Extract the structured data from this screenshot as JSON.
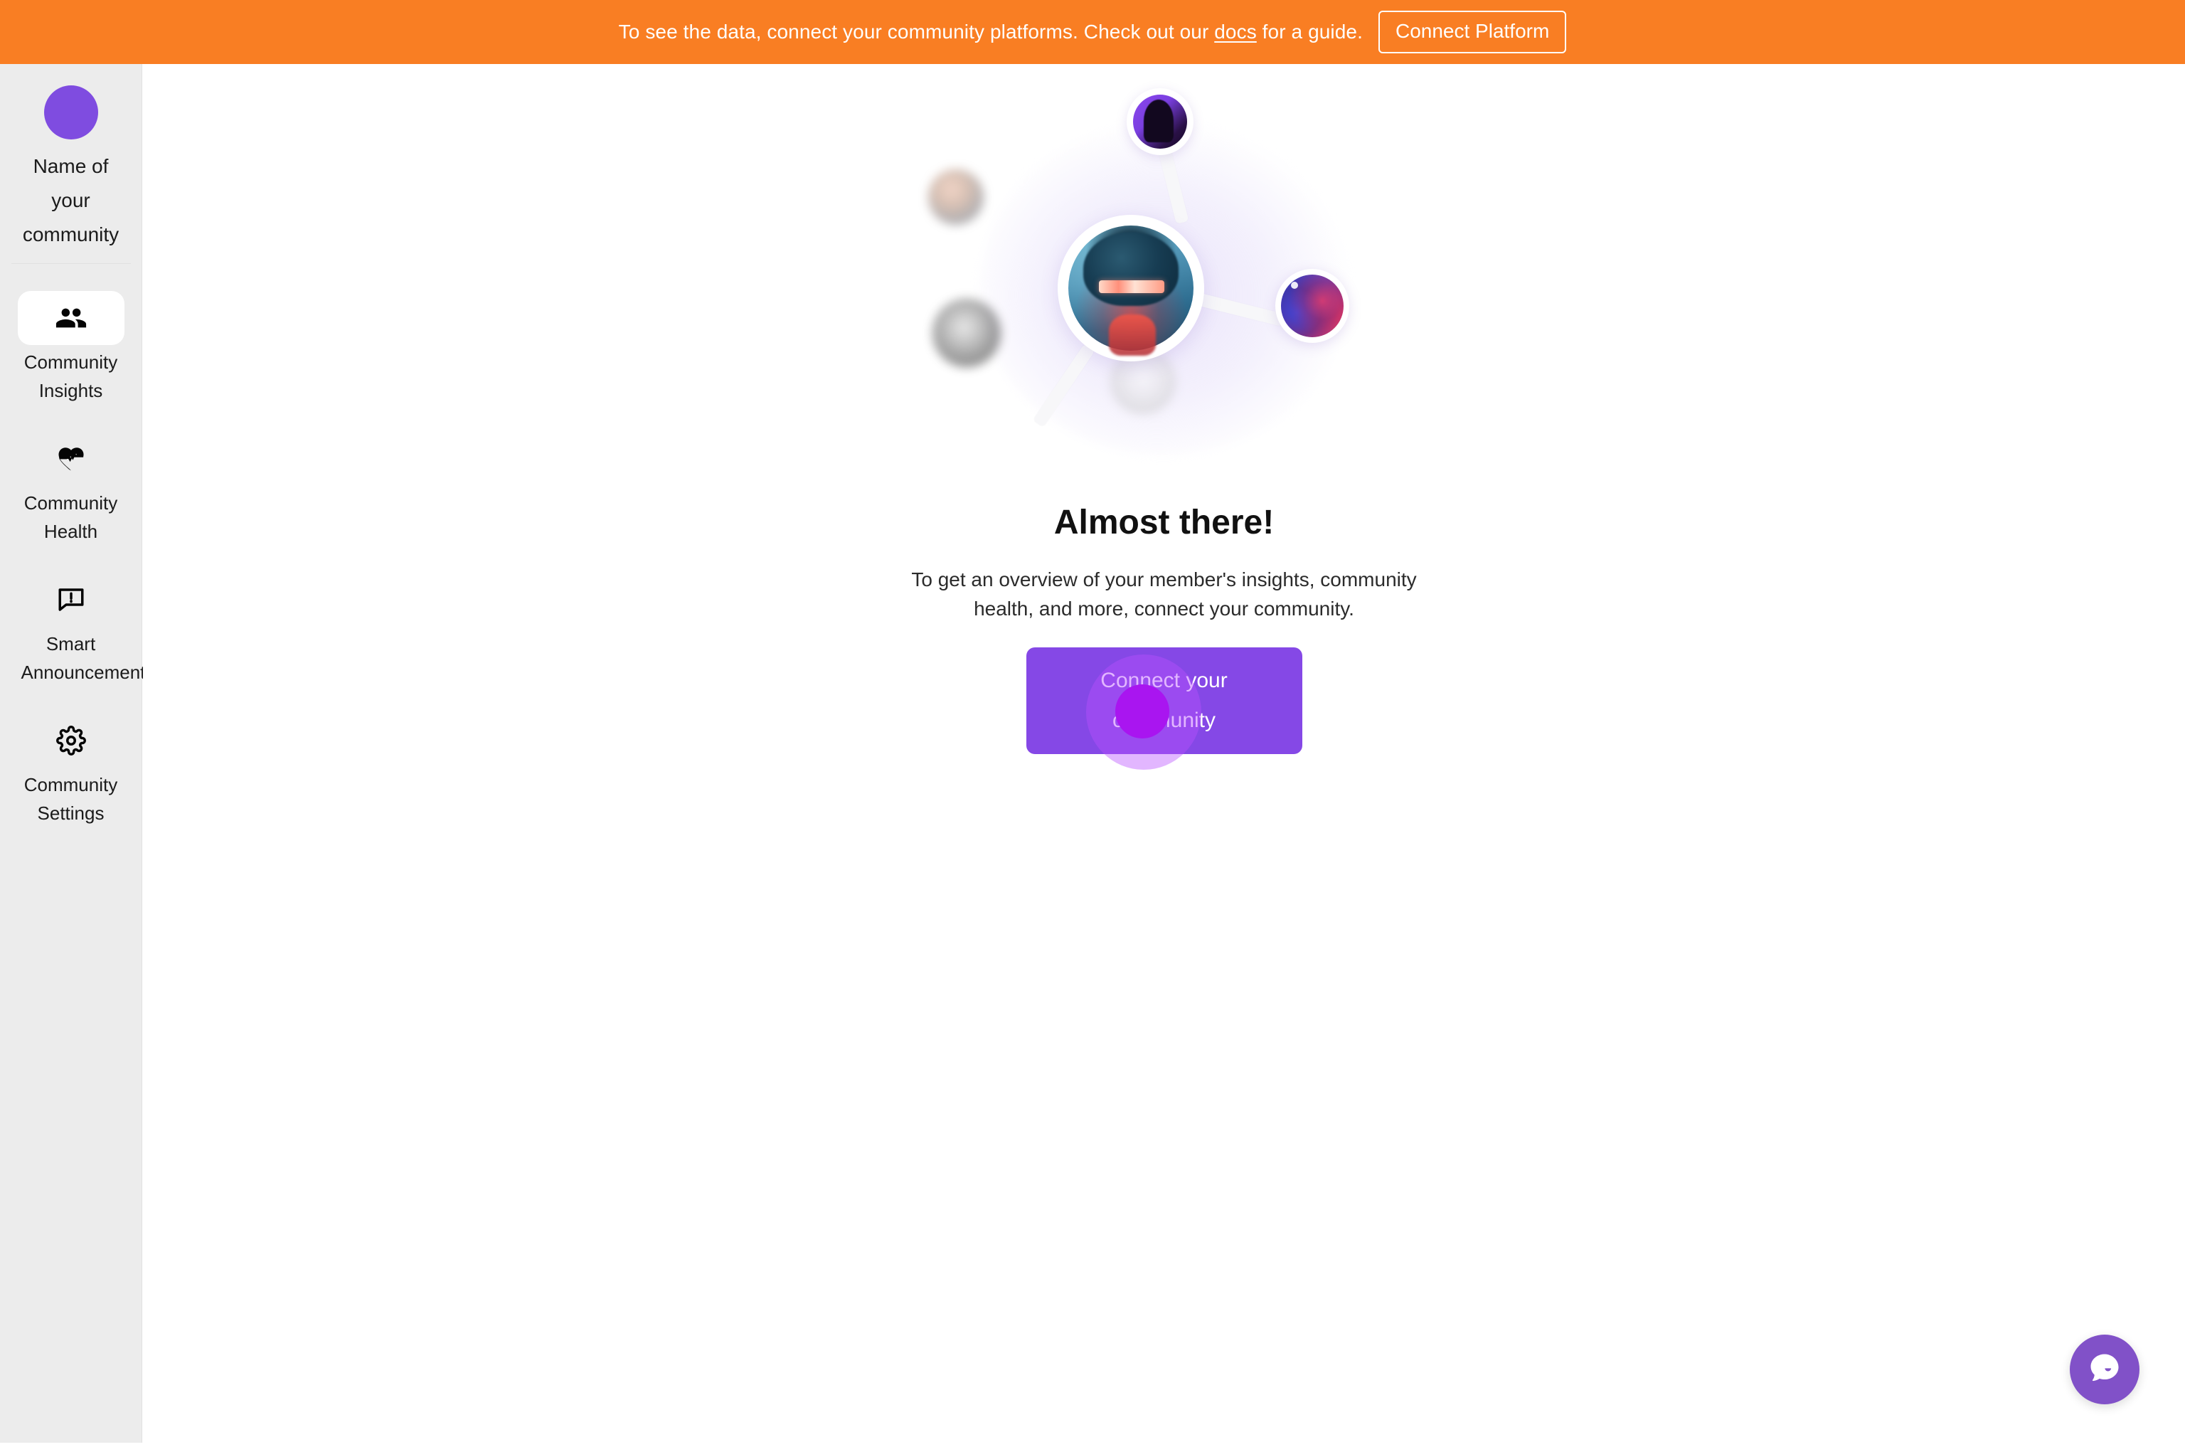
{
  "banner": {
    "text_before": "To see the data, connect your community platforms. Check out our ",
    "link_label": "docs",
    "text_after": " for a guide.",
    "button_label": "Connect Platform",
    "background_color": "#F97E23",
    "text_color": "#FFFFFF"
  },
  "sidebar": {
    "background_color": "#ECECEC",
    "avatar_color": "#7F4CE0",
    "community_name": "Name of your community",
    "items": [
      {
        "label": "Community Insights",
        "icon": "people-icon",
        "active": true
      },
      {
        "label": "Community Health",
        "icon": "heart-pulse-icon",
        "active": false
      },
      {
        "label": "Smart Announcements",
        "icon": "announcement-icon",
        "active": false
      },
      {
        "label": "Community Settings",
        "icon": "gear-icon",
        "active": false
      }
    ]
  },
  "main": {
    "illustration_name": "community-network-illustration",
    "title": "Almost there!",
    "subtitle": "To get an overview of your member's insights, community health, and more, connect your community.",
    "cta_label": "Connect your community",
    "cta_color": "#8548E6",
    "click_indicator": {
      "visible": true,
      "dot_color": "#A915F0",
      "halo_color": "rgba(185,80,255,0.42)"
    }
  },
  "chat_widget": {
    "icon": "chat-bubble-icon",
    "background_color": "#8151C8"
  }
}
